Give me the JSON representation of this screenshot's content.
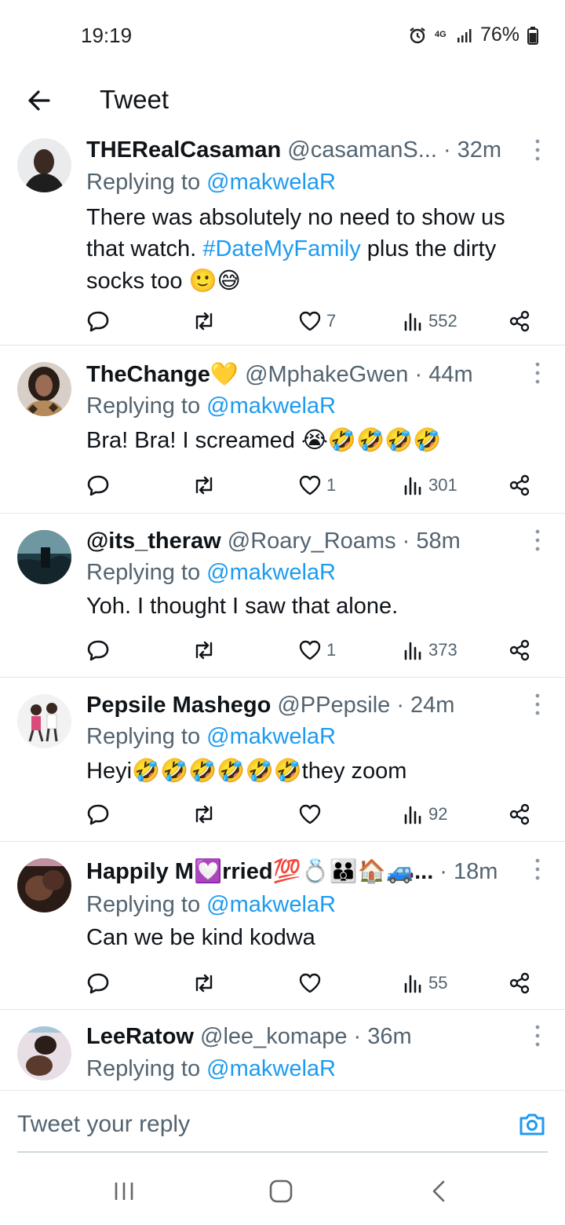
{
  "status_bar": {
    "time": "19:19",
    "network": "4G",
    "battery": "76%",
    "icons": [
      "alarm-icon",
      "network-4g-icon",
      "signal-icon",
      "battery-icon"
    ]
  },
  "header": {
    "back_icon": "arrow-left-icon",
    "title": "Tweet"
  },
  "colors": {
    "link": "#1d9bf0",
    "secondary": "#536471",
    "text": "#0f1419",
    "divider": "#e2e6ea"
  },
  "tweets": [
    {
      "display_name": "THERealCasaman",
      "handle_time": " @casamanS... · 32m",
      "replying_prefix": "Replying to ",
      "mention": "@makwelaR",
      "text_a": "There was absolutely no need to show us that watch. ",
      "hashtag": "#DateMyFamily",
      "text_b": " plus the dirty socks too ",
      "text_emoji": "🙂😅",
      "likes": "7",
      "views": "552"
    },
    {
      "display_name": "TheChange",
      "name_emoji": "💛",
      "handle_time": " @MphakeGwen · 44m",
      "replying_prefix": "Replying to ",
      "mention": "@makwelaR",
      "text_a": "Bra! Bra! I screamed ",
      "text_emoji": "😭🤣🤣🤣🤣",
      "likes": "1",
      "views": "301"
    },
    {
      "display_name": "@its_theraw",
      "handle_time": " @Roary_Roams · 58m",
      "replying_prefix": "Replying to ",
      "mention": "@makwelaR",
      "text_a": "Yoh. I thought I saw that alone.",
      "likes": "1",
      "views": "373"
    },
    {
      "display_name": "Pepsile Mashego",
      "handle_time": " @PPepsile · 24m",
      "replying_prefix": "Replying to ",
      "mention": "@makwelaR",
      "text_a": "Heyi",
      "text_emoji": "🤣🤣🤣🤣🤣🤣",
      "text_b": "they zoom",
      "likes": "",
      "views": "92"
    },
    {
      "display_name": "Happily M💟rried💯💍👪🏠🚙...",
      "handle_time": " · 18m",
      "replying_prefix": "Replying to ",
      "mention": "@makwelaR",
      "text_a": "Can we be kind kodwa",
      "likes": "",
      "views": "55"
    },
    {
      "display_name": "LeeRatow",
      "handle_time": " @lee_komape · 36m",
      "replying_prefix": "Replying to ",
      "mention": "@makwelaR"
    }
  ],
  "composer": {
    "placeholder": "Tweet your reply",
    "camera_icon": "camera-icon"
  },
  "nav_bar": {
    "icons": [
      "recent-apps-icon",
      "home-icon",
      "back-nav-icon"
    ]
  }
}
